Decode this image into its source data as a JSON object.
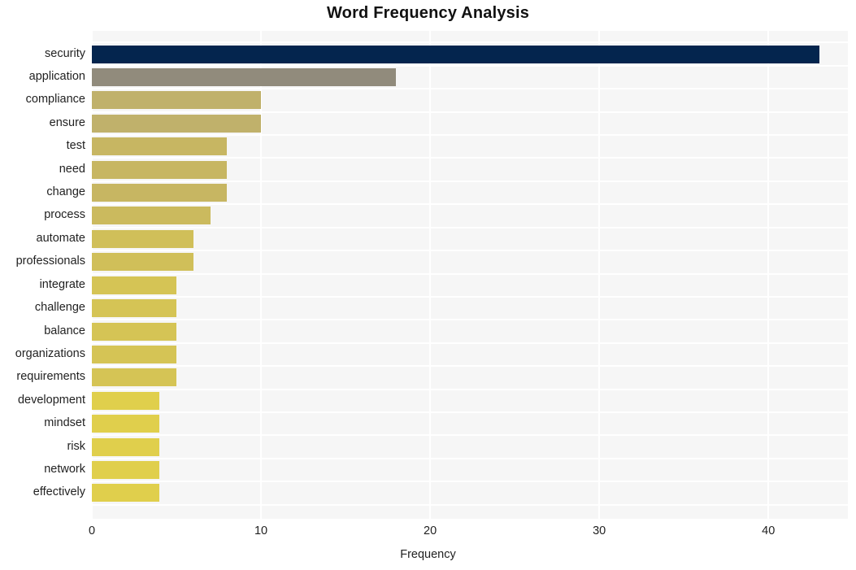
{
  "chart_data": {
    "type": "bar",
    "orientation": "horizontal",
    "title": "Word Frequency Analysis",
    "xlabel": "Frequency",
    "ylabel": "",
    "xlim": [
      0,
      44.7
    ],
    "xticks": [
      0,
      10,
      20,
      30,
      40
    ],
    "xtick_labels": [
      "0",
      "10",
      "20",
      "30",
      "40"
    ],
    "grid": true,
    "grid_axis": "both",
    "legend": false,
    "background": "#f6f6f6",
    "gridline_color": "#ffffff",
    "categories": [
      "security",
      "application",
      "compliance",
      "ensure",
      "test",
      "need",
      "change",
      "process",
      "automate",
      "professionals",
      "integrate",
      "challenge",
      "balance",
      "organizations",
      "requirements",
      "development",
      "mindset",
      "risk",
      "network",
      "effectively"
    ],
    "values": [
      43,
      18,
      10,
      10,
      8,
      8,
      8,
      7,
      6,
      6,
      5,
      5,
      5,
      5,
      5,
      4,
      4,
      4,
      4,
      4
    ],
    "bar_colors": [
      "#04254e",
      "#918b7c",
      "#c0b16b",
      "#c0b16b",
      "#c7b662",
      "#c7b662",
      "#c7b662",
      "#cbba5e",
      "#d0bf59",
      "#d0bf59",
      "#d5c455",
      "#d5c455",
      "#d5c455",
      "#d5c455",
      "#d5c455",
      "#e0cf4c",
      "#e0cf4c",
      "#e0cf4c",
      "#e0cf4c",
      "#e0cf4c"
    ]
  }
}
